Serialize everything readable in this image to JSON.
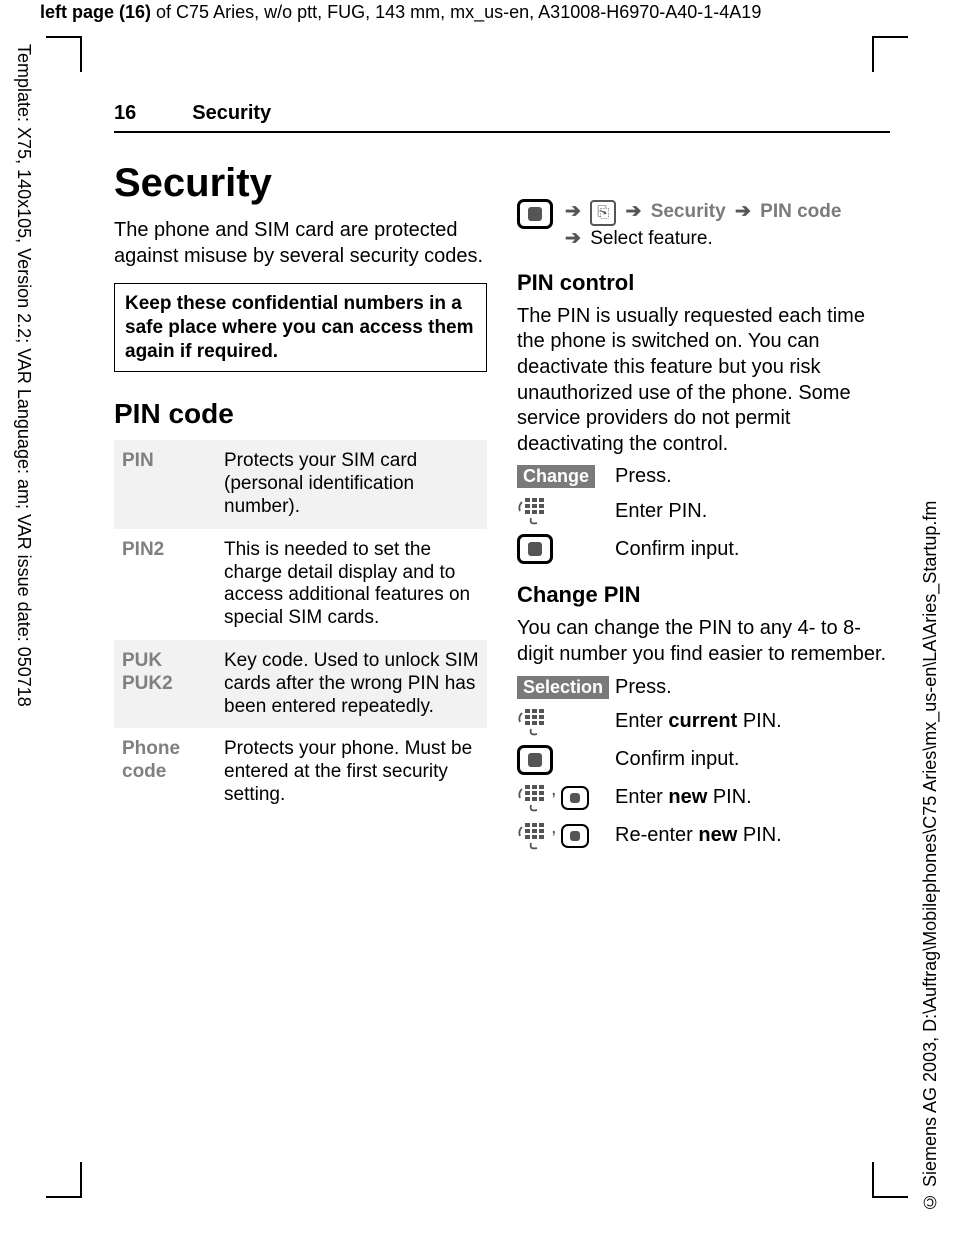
{
  "meta": {
    "top_banner_prefix": "left page (16) ",
    "top_banner_rest": "of C75 Aries, w/o ptt, FUG, 143 mm, mx_us-en, A31008-H6970-A40-1-4A19",
    "vert_left": "Template: X75, 140x105, Version 2.2; VAR Language: am; VAR issue date: 050718",
    "vert_right": "© Siemens AG 2003, D:\\Auftrag\\Mobilephones\\C75 Aries\\mx_us-en\\LA\\Aries_Startup.fm"
  },
  "header": {
    "page_number": "16",
    "section": "Security"
  },
  "left": {
    "h1": "Security",
    "intro": "The phone and SIM card are protected against misuse by several security codes.",
    "note": "Keep these confidential numbers in a safe place where you can access them again if required.",
    "h2_pin_code": "PIN code",
    "table": {
      "r1_term": "PIN",
      "r1_def": "Protects your SIM card (personal identification number).",
      "r2_term": "PIN2",
      "r2_def": "This is needed to set the charge detail display and to access additional features on special SIM cards.",
      "r3_term_a": "PUK",
      "r3_term_b": "PUK2",
      "r3_def": "Key code. Used to unlock SIM cards after the wrong PIN has been entered repeatedly.",
      "r4_term_a": "Phone",
      "r4_term_b": "code",
      "r4_def": "Protects your phone. Must be entered at the first security setting."
    }
  },
  "right": {
    "nav": {
      "security": "Security",
      "pin_code": "PIN code",
      "select_feature": "Select feature."
    },
    "h3_pin_control": "PIN control",
    "pin_control_body": "The PIN is usually requested each time the phone is switched on. You can deactivate this feature but you risk unauthorized use of the phone. Some service providers do not permit deactivating the control.",
    "softkey_change": "Change",
    "press": "Press.",
    "enter_pin": "Enter PIN.",
    "confirm_input": "Confirm input.",
    "h3_change_pin": "Change PIN",
    "change_pin_body": "You can change the PIN to any 4- to 8-digit number you find easier to remember.",
    "softkey_selection": "Selection",
    "enter_current_pre": "Enter ",
    "enter_current_bold": "current",
    "enter_current_post": " PIN.",
    "enter_new_pre": "Enter ",
    "enter_new_bold": "new",
    "enter_new_post": " PIN.",
    "reenter_new_pre": "Re-enter ",
    "reenter_new_bold": "new",
    "reenter_new_post": " PIN."
  }
}
